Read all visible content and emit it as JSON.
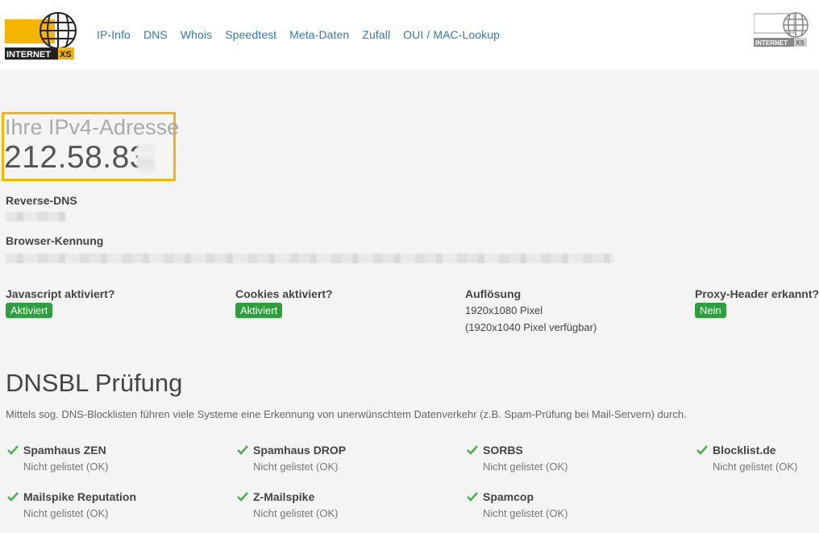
{
  "header": {
    "logo_text_main": "INTERNET",
    "logo_text_accent": "XS",
    "nav": [
      "IP-Info",
      "DNS",
      "Whois",
      "Speedtest",
      "Meta-Daten",
      "Zufall",
      "OUI / MAC-Lookup"
    ]
  },
  "ip": {
    "title": "Ihre IPv4-Adresse",
    "value": "212.58.83."
  },
  "reverse_dns": {
    "label": "Reverse-DNS"
  },
  "browser_id": {
    "label": "Browser-Kennung"
  },
  "features": {
    "javascript": {
      "label": "Javascript aktiviert?",
      "value": "Aktiviert"
    },
    "cookies": {
      "label": "Cookies aktiviert?",
      "value": "Aktiviert"
    },
    "resolution": {
      "label": "Auflösung",
      "line1": "1920x1080 Pixel",
      "line2": "(1920x1040 Pixel verfügbar)"
    },
    "proxy": {
      "label": "Proxy-Header erkannt?",
      "value": "Nein"
    }
  },
  "dnsbl": {
    "title": "DNSBL Prüfung",
    "description": "Mittels sog. DNS-Blocklisten führen viele Systeme eine Erkennung von unerwünschtem Datenverkehr (z.B. Spam-Prüfung bei Mail-Servern) durch.",
    "items": [
      {
        "name": "Spamhaus ZEN",
        "status": "Nicht gelistet (OK)"
      },
      {
        "name": "Spamhaus DROP",
        "status": "Nicht gelistet (OK)"
      },
      {
        "name": "SORBS",
        "status": "Nicht gelistet (OK)"
      },
      {
        "name": "Blocklist.de",
        "status": "Nicht gelistet (OK)"
      },
      {
        "name": "Mailspike Reputation",
        "status": "Nicht gelistet (OK)"
      },
      {
        "name": "Z-Mailspike",
        "status": "Nicht gelistet (OK)"
      },
      {
        "name": "Spamcop",
        "status": "Nicht gelistet (OK)"
      }
    ]
  },
  "colors": {
    "accent": "#f5b400",
    "link": "#2f79b9",
    "ok": "#2e9e3f"
  }
}
